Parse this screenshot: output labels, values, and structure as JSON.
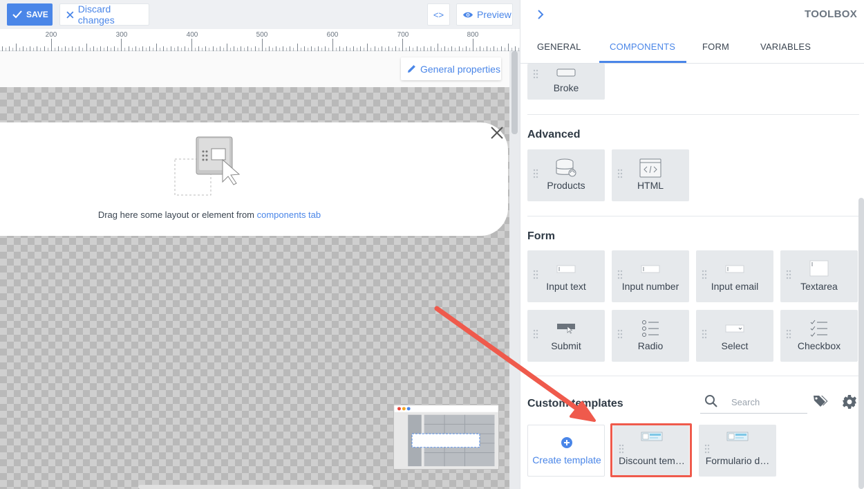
{
  "topbar": {
    "save_label": "SAVE",
    "discard_label": "Discard changes",
    "code_label": "<>",
    "preview_label": "Preview"
  },
  "ruler": {
    "labels": [
      "200",
      "300",
      "400",
      "500",
      "600",
      "700",
      "800"
    ]
  },
  "canvas": {
    "general_properties_label": "General properties",
    "drop_text": "Drag here some layout or element from ",
    "drop_link": "components tab"
  },
  "toolbox": {
    "title": "TOOLBOX",
    "tabs": [
      {
        "label": "GENERAL",
        "active": false
      },
      {
        "label": "COMPONENTS",
        "active": true
      },
      {
        "label": "FORM",
        "active": false
      },
      {
        "label": "VARIABLES",
        "active": false
      }
    ],
    "broke_label": "Broke",
    "advanced": {
      "title": "Advanced",
      "items": [
        {
          "label": "Products",
          "icon": "products-icon"
        },
        {
          "label": "HTML",
          "icon": "html-icon"
        }
      ]
    },
    "form": {
      "title": "Form",
      "items": [
        {
          "label": "Input text",
          "icon": "input-text-icon"
        },
        {
          "label": "Input number",
          "icon": "input-number-icon"
        },
        {
          "label": "Input email",
          "icon": "input-email-icon"
        },
        {
          "label": "Textarea",
          "icon": "textarea-icon"
        },
        {
          "label": "Submit",
          "icon": "submit-icon"
        },
        {
          "label": "Radio",
          "icon": "radio-icon"
        },
        {
          "label": "Select",
          "icon": "select-icon"
        },
        {
          "label": "Checkbox",
          "icon": "checkbox-icon"
        }
      ]
    },
    "custom_templates": {
      "title": "Custom templates",
      "search_placeholder": "Search",
      "create_label": "Create template",
      "templates": [
        {
          "label": "Discount tem…",
          "highlighted": true
        },
        {
          "label": "Formulario d…",
          "highlighted": false
        }
      ]
    }
  },
  "colors": {
    "accent": "#4a86e8",
    "highlight": "#ef5a4c"
  }
}
